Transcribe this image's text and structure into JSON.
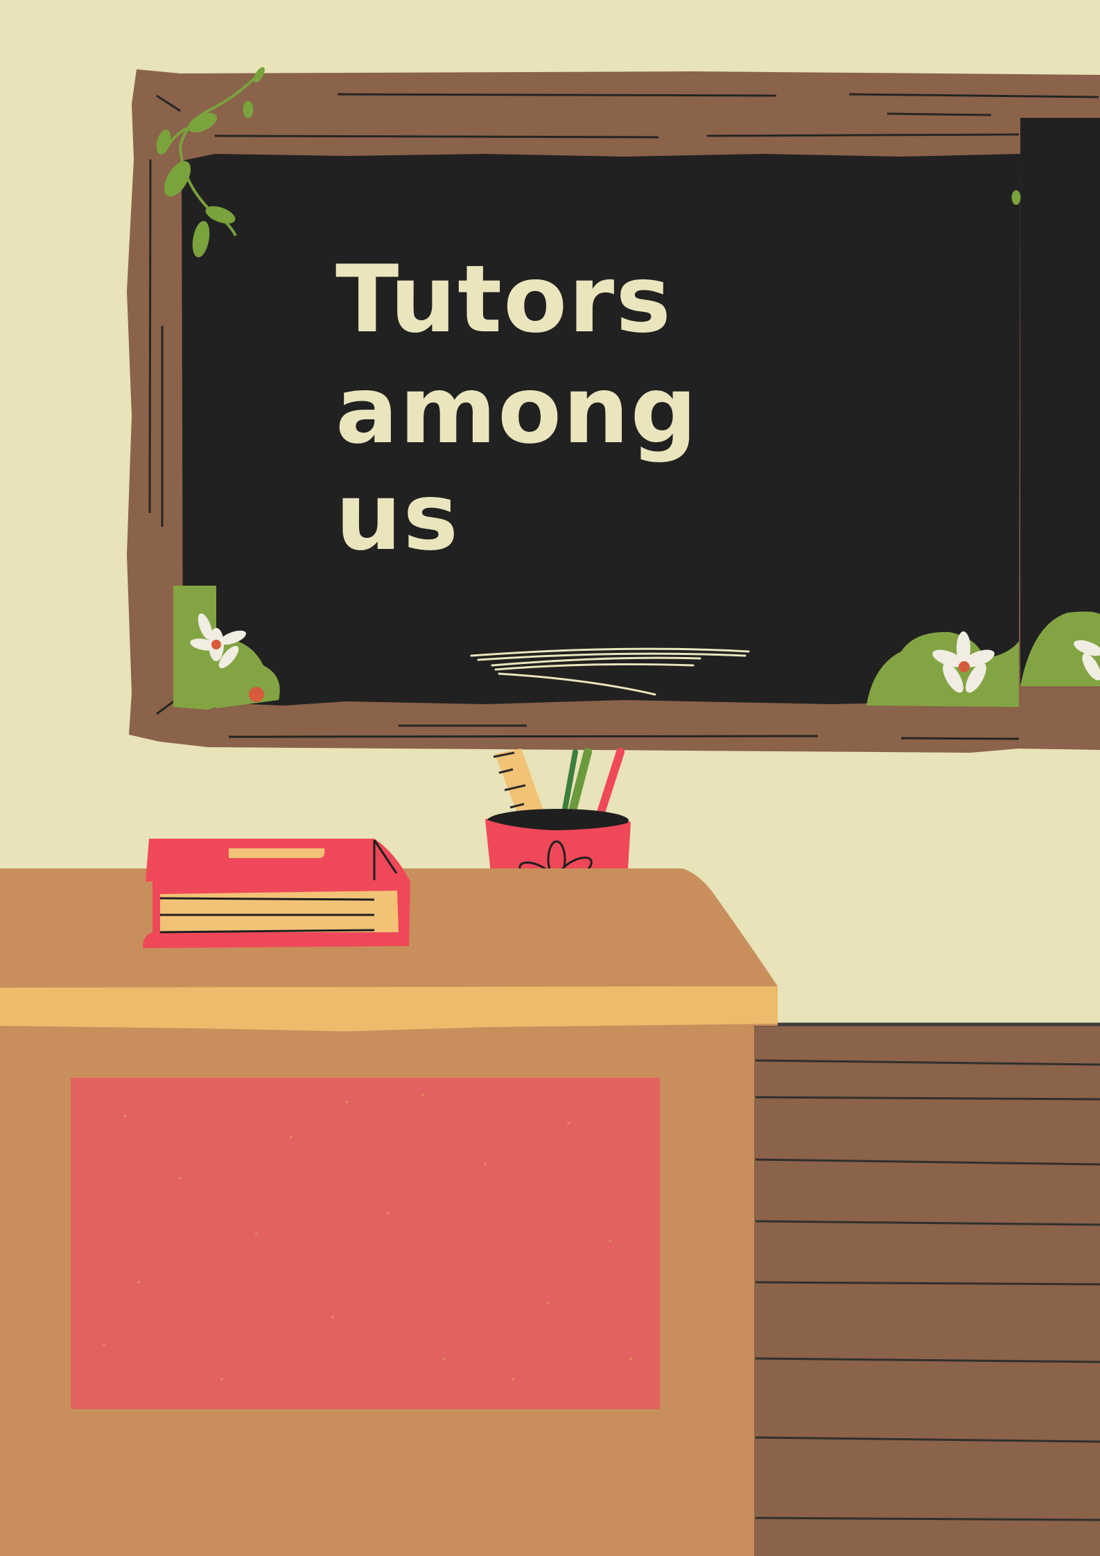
{
  "poster": {
    "title_lines": [
      "Tutors",
      "among",
      "us"
    ]
  },
  "colors": {
    "wall": "#e8e3b9",
    "chalkboard": "#212121",
    "frame_wood": "#8b624a",
    "chalk_text": "#eae5bd",
    "leaf_green": "#83a443",
    "desk_top": "#c88f5c",
    "desk_edge": "#edbb6c",
    "desk_panel": "#e26260",
    "book_cover": "#ef4859",
    "book_pages": "#f2c276",
    "cup": "#ef4859",
    "floor_wood": "#8b624a"
  },
  "icons": [
    "vine-icon",
    "daisy-icon",
    "ruler-icon",
    "pencil-icon",
    "flower-icon"
  ]
}
